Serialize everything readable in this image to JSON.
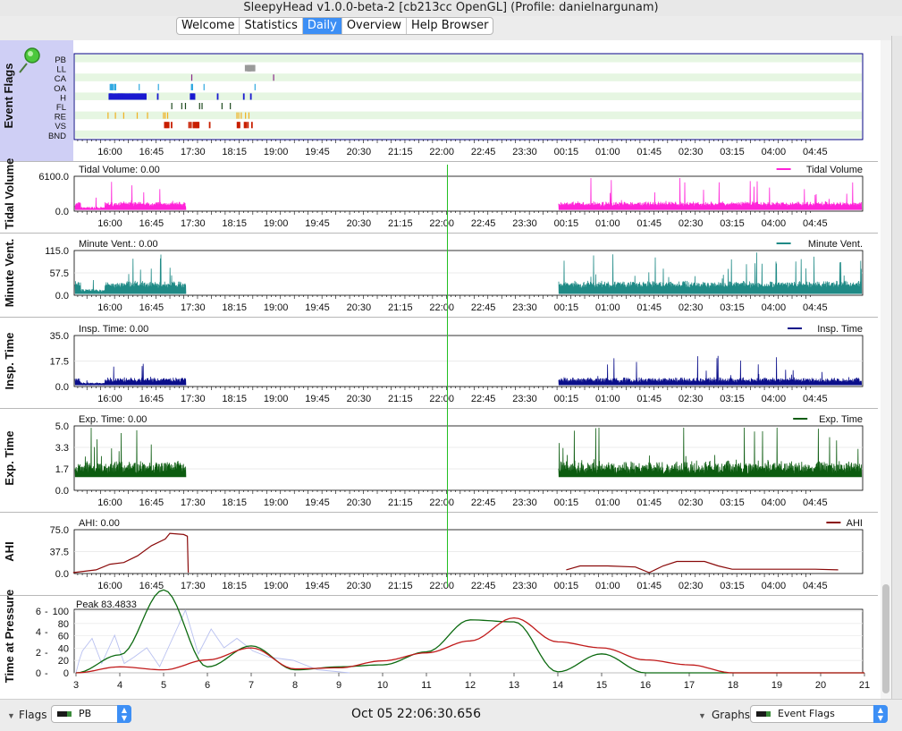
{
  "window": {
    "title": "SleepyHead v1.0.0-beta-2 [cb213cc OpenGL] (Profile: danielnargunam)"
  },
  "tabs": [
    {
      "label": "Welcome",
      "active": false
    },
    {
      "label": "Statistics",
      "active": false
    },
    {
      "label": "Daily",
      "active": true
    },
    {
      "label": "Overview",
      "active": false
    },
    {
      "label": "Help Browser",
      "active": false
    }
  ],
  "time_axis": {
    "labels": [
      "16:00",
      "16:45",
      "17:30",
      "18:15",
      "19:00",
      "19:45",
      "20:30",
      "21:15",
      "22:00",
      "22:45",
      "23:30",
      "00:15",
      "01:00",
      "01:45",
      "02:30",
      "03:15",
      "04:00",
      "04:45"
    ],
    "cursor_time": "22:06:30"
  },
  "event_flags": {
    "title": "Event Flags",
    "pin_icon": "pushpin-icon",
    "rows": [
      "PB",
      "LL",
      "CA",
      "OA",
      "H",
      "FL",
      "RE",
      "VS",
      "BND"
    ],
    "colors": {
      "PB": "#bdbdbd",
      "LL": "#9a9a9a",
      "CA": "#8a2b8a",
      "OA": "#2fa8e0",
      "H": "#1a1ad0",
      "FL": "#1e4a1e",
      "RE": "#f0b020",
      "VS": "#c81e00",
      "BND": "#555555"
    },
    "events": {
      "PB": [],
      "LL": [
        8780,
        8920,
        8940,
        8960,
        8980,
        9000,
        9200,
        9230
      ],
      "CA": [
        5290,
        10620
      ],
      "OA": [
        -20,
        40,
        70,
        100,
        160,
        260,
        290,
        340,
        1870,
        3120,
        5270,
        5310,
        5340,
        6090,
        9410
      ],
      "H": [
        -90,
        -60,
        -20,
        10,
        40,
        80,
        120,
        200,
        290,
        320,
        400,
        450,
        500,
        530,
        560,
        600,
        650,
        690,
        720,
        760,
        800,
        850,
        890,
        950,
        1020,
        1080,
        1150,
        1220,
        1260,
        1330,
        1400,
        1450,
        1510,
        1570,
        1650,
        1720,
        1780,
        1830,
        1900,
        1960,
        2030,
        2070,
        2140,
        2210,
        2280,
        3060,
        5200,
        5230,
        5260,
        5320,
        5360,
        5390,
        5450,
        6960,
        8660,
        9120
      ],
      "FL": [
        3990,
        4640,
        4880,
        5800,
        5960,
        7260,
        7800
      ],
      "RE": [
        -160,
        320,
        860,
        1740,
        2410,
        3450,
        3560,
        3720,
        8230,
        8350,
        8510,
        8790,
        9010
      ],
      "VS": [
        3520,
        3600,
        3680,
        3770,
        3960,
        5100,
        5220,
        5380,
        5440,
        5520,
        5580,
        5650,
        5720,
        6440,
        8250,
        8310,
        8380,
        8710,
        8810,
        8930,
        9190
      ],
      "BND": []
    }
  },
  "panels": [
    {
      "id": "tidal",
      "title": "Tidal Volume",
      "readout": "Tidal Volume: 0.00",
      "legend": "Tidal Volume",
      "color": "#ff22d8",
      "yticks": [
        "6100.0",
        "0.0"
      ]
    },
    {
      "id": "minvent",
      "title": "Minute Vent.",
      "readout": "Minute Vent.: 0.00",
      "legend": "Minute Vent.",
      "color": "#1f8a86",
      "yticks": [
        "115.0",
        "57.5",
        "0.0"
      ]
    },
    {
      "id": "insp",
      "title": "Insp. Time",
      "readout": "Insp. Time: 0.00",
      "legend": "Insp. Time",
      "color": "#0a0e8a",
      "yticks": [
        "35.0",
        "17.5",
        "0.0"
      ]
    },
    {
      "id": "exp",
      "title": "Exp. Time",
      "readout": "Exp. Time: 0.00",
      "legend": "Exp. Time",
      "color": "#0c5c10",
      "yticks": [
        "5.0",
        "3.3",
        "1.7",
        "0.0"
      ]
    },
    {
      "id": "ahi",
      "title": "AHI",
      "readout": "AHI: 0.00",
      "legend": "AHI",
      "color": "#8a0a0a",
      "yticks": [
        "75.0",
        "37.5",
        "0.0"
      ]
    }
  ],
  "pressure": {
    "title": "Time at Pressure",
    "readout": "Peak 83.4833",
    "left_ticks": [
      "6",
      "4",
      "2",
      "0"
    ],
    "right_ticks": [
      "100",
      "80",
      "60",
      "40",
      "20",
      "0"
    ],
    "xticks": [
      "3",
      "4",
      "5",
      "6",
      "7",
      "8",
      "9",
      "10",
      "11",
      "12",
      "13",
      "14",
      "15",
      "16",
      "17",
      "18",
      "19",
      "20",
      "21"
    ]
  },
  "chart_data": [
    {
      "type": "line",
      "title": "AHI",
      "x": [
        "15:20",
        "15:45",
        "16:00",
        "16:15",
        "16:30",
        "16:45",
        "17:00",
        "17:05",
        "17:20",
        "17:24",
        "17:25",
        "00:15",
        "00:30",
        "01:00",
        "01:30",
        "01:45",
        "02:00",
        "02:15",
        "02:45",
        "03:00",
        "03:15",
        "03:30",
        "04:00",
        "04:30",
        "04:45",
        "05:10"
      ],
      "series": [
        {
          "name": "AHI",
          "values": [
            0,
            5,
            15,
            18,
            30,
            48,
            60,
            70,
            68,
            65,
            0,
            5,
            12,
            12,
            10,
            0,
            12,
            20,
            20,
            12,
            6,
            6,
            6,
            6,
            6,
            5
          ]
        }
      ],
      "ylim": [
        0,
        75
      ]
    },
    {
      "type": "line",
      "title": "Time at Pressure",
      "x": [
        3,
        4,
        5,
        6,
        7,
        8,
        9,
        10,
        11,
        12,
        13,
        14,
        15,
        16,
        17,
        18,
        19,
        20,
        21
      ],
      "series": [
        {
          "name": "",
          "color": "#0c6a10",
          "values": [
            0,
            1.8,
            8.3,
            0.6,
            2.7,
            0.3,
            0.6,
            0.8,
            2.1,
            5.3,
            5.1,
            0.1,
            1.9,
            0,
            0,
            0,
            0,
            0,
            0
          ]
        },
        {
          "name": "",
          "color": "#c01a1a",
          "values": [
            0,
            0.6,
            0.3,
            1.3,
            2.5,
            0.4,
            0.5,
            1.2,
            2.0,
            3.2,
            5.5,
            3.1,
            2.5,
            1.3,
            0.8,
            0,
            0,
            0,
            0
          ]
        }
      ],
      "ylim": [
        0,
        6
      ]
    }
  ],
  "bottom": {
    "flags_label": "Flags",
    "flags_value": "PB",
    "datetime": "Oct 05 22:06:30.656",
    "graphs_label": "Graphs",
    "graphs_value": "Event Flags"
  }
}
